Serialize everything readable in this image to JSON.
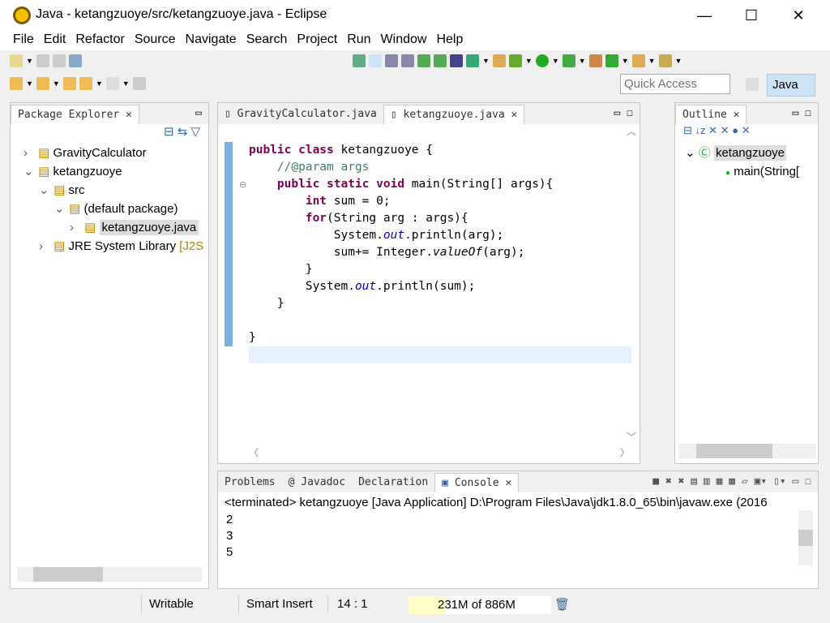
{
  "window": {
    "title": "Java - ketangzuoye/src/ketangzuoye.java - Eclipse",
    "minimize": "—",
    "maximize": "☐",
    "close": "✕"
  },
  "menu": [
    "File",
    "Edit",
    "Refactor",
    "Source",
    "Navigate",
    "Search",
    "Project",
    "Run",
    "Window",
    "Help"
  ],
  "toolbar": {
    "quick_access_placeholder": "Quick Access",
    "perspective": "Java"
  },
  "package_explorer": {
    "title": "Package Explorer",
    "items": [
      {
        "label": "GravityCalculator",
        "indent": 0,
        "expander": "›",
        "icon": "project-icon"
      },
      {
        "label": "ketangzuoye",
        "indent": 0,
        "expander": "⌄",
        "icon": "project-icon"
      },
      {
        "label": "src",
        "indent": 1,
        "expander": "⌄",
        "icon": "source-folder-icon"
      },
      {
        "label": "(default package)",
        "indent": 2,
        "expander": "⌄",
        "icon": "package-icon"
      },
      {
        "label": "ketangzuoye.java",
        "indent": 3,
        "expander": "›",
        "icon": "java-file-icon",
        "selected": true
      },
      {
        "label": "JRE System Library",
        "suffix": "[J2S",
        "indent": 1,
        "expander": "›",
        "icon": "library-icon"
      }
    ]
  },
  "editor": {
    "tabs": [
      {
        "label": "GravityCalculator.java",
        "active": false
      },
      {
        "label": "ketangzuoye.java",
        "active": true
      }
    ],
    "lines": [
      [
        {
          "t": "public class ",
          "c": "kw"
        },
        {
          "t": "ketangzuoye {",
          "c": ""
        }
      ],
      [
        {
          "t": "    //@param args",
          "c": "cm"
        }
      ],
      [
        {
          "t": "    public static void ",
          "c": "kw"
        },
        {
          "t": "main(String[] args){",
          "c": ""
        }
      ],
      [
        {
          "t": "        ",
          "c": ""
        },
        {
          "t": "int ",
          "c": "kw"
        },
        {
          "t": "sum = 0;",
          "c": ""
        }
      ],
      [
        {
          "t": "        ",
          "c": ""
        },
        {
          "t": "for",
          "c": "kw"
        },
        {
          "t": "(String arg : args){",
          "c": ""
        }
      ],
      [
        {
          "t": "            System.",
          "c": ""
        },
        {
          "t": "out",
          "c": "fld"
        },
        {
          "t": ".println(arg);",
          "c": ""
        }
      ],
      [
        {
          "t": "            sum+= Integer.",
          "c": ""
        },
        {
          "t": "valueOf",
          "c": "it"
        },
        {
          "t": "(arg);",
          "c": ""
        }
      ],
      [
        {
          "t": "        }",
          "c": ""
        }
      ],
      [
        {
          "t": "        System.",
          "c": ""
        },
        {
          "t": "out",
          "c": "fld"
        },
        {
          "t": ".println(sum);",
          "c": ""
        }
      ],
      [
        {
          "t": "    }",
          "c": ""
        }
      ],
      [
        {
          "t": "",
          "c": ""
        }
      ],
      [
        {
          "t": "}",
          "c": ""
        }
      ]
    ]
  },
  "outline": {
    "title": "Outline",
    "items": [
      {
        "label": "ketangzuoye"
      },
      {
        "label": "main(String["
      }
    ]
  },
  "console": {
    "tabs": [
      "Problems",
      "Javadoc",
      "Declaration",
      "Console"
    ],
    "header": "<terminated> ketangzuoye [Java Application] D:\\Program Files\\Java\\jdk1.8.0_65\\bin\\javaw.exe (2016",
    "output": [
      "2",
      "3",
      "5"
    ]
  },
  "status": {
    "writable": "Writable",
    "insert_mode": "Smart Insert",
    "position": "14 : 1",
    "heap": "231M of 886M",
    "heap_fraction": 0.26
  }
}
